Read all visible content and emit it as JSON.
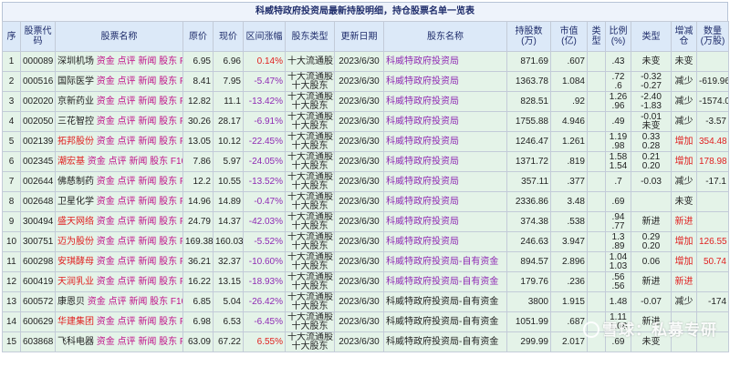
{
  "title": "科威特政府投资局最新持股明细，持仓股票名单一览表",
  "headers": [
    "序",
    "股票代码",
    "股票名称",
    "原价",
    "现价",
    "区间涨幅",
    "股东类型",
    "更新日期",
    "股东名称",
    "持股数(万)",
    "市值(亿)",
    "类型",
    "比例(%)",
    "类型",
    "增减仓",
    "数量(万股)"
  ],
  "links": [
    "资金",
    "点评",
    "新闻",
    "股东",
    "F10"
  ],
  "rows": [
    {
      "idx": "1",
      "code": "000089",
      "name": "深圳机场",
      "name_color": "nm",
      "orig": "6.95",
      "now": "6.96",
      "chg": "0.14%",
      "chg_up": true,
      "holder_type": [
        "十大流通股东"
      ],
      "date": "2023/6/30",
      "holder": "科威特政府投资局",
      "holder_color": "hold",
      "shares": "871.69",
      "mv": ".607",
      "ptype": "",
      "ratio": ".43",
      "t2": "未变",
      "act": "未变",
      "act_red": false,
      "qty": ""
    },
    {
      "idx": "2",
      "code": "000516",
      "name": "国际医学",
      "name_color": "nm",
      "orig": "8.41",
      "now": "7.95",
      "chg": "-5.47%",
      "chg_up": false,
      "holder_type": [
        "十大流通股东",
        "十大股东"
      ],
      "date": "2023/6/30",
      "holder": "科威特政府投资局",
      "holder_color": "hold",
      "shares": "1363.78",
      "mv": "1.084",
      "ptype": "",
      "ratio": ".72\n.6",
      "t2": "-0.32\n-0.27",
      "act": "减少",
      "act_red": false,
      "qty": "-619.96"
    },
    {
      "idx": "3",
      "code": "002020",
      "name": "京新药业",
      "name_color": "nm",
      "orig": "12.82",
      "now": "11.1",
      "chg": "-13.42%",
      "chg_up": false,
      "holder_type": [
        "十大流通股东",
        "十大股东"
      ],
      "date": "2023/6/30",
      "holder": "科威特政府投资局",
      "holder_color": "hold",
      "shares": "828.51",
      "mv": ".92",
      "ptype": "",
      "ratio": "1.26\n.96",
      "t2": "-2.40\n-1.83",
      "act": "减少",
      "act_red": false,
      "qty": "-1574.09"
    },
    {
      "idx": "4",
      "code": "002050",
      "name": "三花智控",
      "name_color": "nm",
      "orig": "30.26",
      "now": "28.17",
      "chg": "-6.91%",
      "chg_up": false,
      "holder_type": [
        "十大流通股东",
        "十大股东"
      ],
      "date": "2023/6/30",
      "holder": "科威特政府投资局",
      "holder_color": "hold",
      "shares": "1755.88",
      "mv": "4.946",
      "ptype": "",
      "ratio": ".49",
      "t2": "-0.01\n未变",
      "act": "减少",
      "act_red": false,
      "qty": "-3.57"
    },
    {
      "idx": "5",
      "code": "002139",
      "name": "拓邦股份",
      "name_color": "red",
      "orig": "13.05",
      "now": "10.12",
      "chg": "-22.45%",
      "chg_up": false,
      "holder_type": [
        "十大流通股东",
        "十大股东"
      ],
      "date": "2023/6/30",
      "holder": "科威特政府投资局",
      "holder_color": "hold",
      "shares": "1246.47",
      "mv": "1.261",
      "ptype": "",
      "ratio": "1.19\n.98",
      "t2": "0.33\n0.28",
      "act": "增加",
      "act_red": true,
      "qty": "354.48"
    },
    {
      "idx": "6",
      "code": "002345",
      "name": "潮宏基",
      "name_color": "red",
      "orig": "7.86",
      "now": "5.97",
      "chg": "-24.05%",
      "chg_up": false,
      "holder_type": [
        "十大流通股东",
        "十大股东"
      ],
      "date": "2023/6/30",
      "holder": "科威特政府投资局",
      "holder_color": "hold",
      "shares": "1371.72",
      "mv": ".819",
      "ptype": "",
      "ratio": "1.58\n1.54",
      "t2": "0.21\n0.20",
      "act": "增加",
      "act_red": true,
      "qty": "178.98"
    },
    {
      "idx": "7",
      "code": "002644",
      "name": "佛慈制药",
      "name_color": "nm",
      "orig": "12.2",
      "now": "10.55",
      "chg": "-13.52%",
      "chg_up": false,
      "holder_type": [
        "十大流通股东",
        "十大股东"
      ],
      "date": "2023/6/30",
      "holder": "科威特政府投资局",
      "holder_color": "hold",
      "shares": "357.11",
      "mv": ".377",
      "ptype": "",
      "ratio": ".7",
      "t2": "-0.03",
      "act": "减少",
      "act_red": false,
      "qty": "-17.1"
    },
    {
      "idx": "8",
      "code": "002648",
      "name": "卫星化学",
      "name_color": "nm",
      "orig": "14.96",
      "now": "14.89",
      "chg": "-0.47%",
      "chg_up": false,
      "holder_type": [
        "十大流通股东",
        "十大股东"
      ],
      "date": "2023/6/30",
      "holder": "科威特政府投资局",
      "holder_color": "hold",
      "shares": "2336.86",
      "mv": "3.48",
      "ptype": "",
      "ratio": ".69",
      "t2": "",
      "act": "未变",
      "act_red": false,
      "qty": ""
    },
    {
      "idx": "9",
      "code": "300494",
      "name": "盛天网络",
      "name_color": "red",
      "orig": "24.79",
      "now": "14.37",
      "chg": "-42.03%",
      "chg_up": false,
      "holder_type": [
        "十大流通股东",
        "十大股东"
      ],
      "date": "2023/6/30",
      "holder": "科威特政府投资局",
      "holder_color": "hold",
      "shares": "374.38",
      "mv": ".538",
      "ptype": "",
      "ratio": ".94\n.77",
      "t2": "新进",
      "act": "新进",
      "act_red": true,
      "qty": ""
    },
    {
      "idx": "10",
      "code": "300751",
      "name": "迈为股份",
      "name_color": "red",
      "orig": "169.38",
      "now": "160.03",
      "chg": "-5.52%",
      "chg_up": false,
      "holder_type": [
        "十大流通股东",
        "十大股东"
      ],
      "date": "2023/6/30",
      "holder": "科威特政府投资局",
      "holder_color": "hold",
      "shares": "246.63",
      "mv": "3.947",
      "ptype": "",
      "ratio": "1.3\n.89",
      "t2": "0.29\n0.20",
      "act": "增加",
      "act_red": true,
      "qty": "126.55"
    },
    {
      "idx": "11",
      "code": "600298",
      "name": "安琪酵母",
      "name_color": "red",
      "orig": "36.21",
      "now": "32.37",
      "chg": "-10.60%",
      "chg_up": false,
      "holder_type": [
        "十大流通股东",
        "十大股东"
      ],
      "date": "2023/6/30",
      "holder": "科威特政府投资局-自有资金",
      "holder_color": "hold",
      "shares": "894.57",
      "mv": "2.896",
      "ptype": "",
      "ratio": "1.04\n1.03",
      "t2": "0.06",
      "act": "增加",
      "act_red": true,
      "qty": "50.74"
    },
    {
      "idx": "12",
      "code": "600419",
      "name": "天润乳业",
      "name_color": "red",
      "orig": "16.22",
      "now": "13.15",
      "chg": "-18.93%",
      "chg_up": false,
      "holder_type": [
        "十大流通股东",
        "十大股东"
      ],
      "date": "2023/6/30",
      "holder": "科威特政府投资局-自有资金",
      "holder_color": "hold",
      "shares": "179.76",
      "mv": ".236",
      "ptype": "",
      "ratio": ".56\n.56",
      "t2": "新进",
      "act": "新进",
      "act_red": true,
      "qty": ""
    },
    {
      "idx": "13",
      "code": "600572",
      "name": "康恩贝",
      "name_color": "nm",
      "orig": "6.85",
      "now": "5.04",
      "chg": "-26.42%",
      "chg_up": false,
      "holder_type": [
        "十大流通股东",
        "十大股东"
      ],
      "date": "2023/6/30",
      "holder": "科威特政府投资局-自有资金",
      "holder_color": "nm",
      "shares": "3800",
      "mv": "1.915",
      "ptype": "",
      "ratio": "1.48",
      "t2": "-0.07",
      "act": "减少",
      "act_red": false,
      "qty": "-174"
    },
    {
      "idx": "14",
      "code": "600629",
      "name": "华建集团",
      "name_color": "red",
      "orig": "6.98",
      "now": "6.53",
      "chg": "-6.45%",
      "chg_up": false,
      "holder_type": [
        "十大流通股东",
        "十大股东"
      ],
      "date": "2023/6/30",
      "holder": "科威特政府投资局-自有资金",
      "holder_color": "nm",
      "shares": "1051.99",
      "mv": ".687",
      "ptype": "",
      "ratio": "1.11\n1.08",
      "t2": "新进",
      "act": "",
      "act_red": true,
      "qty": ""
    },
    {
      "idx": "15",
      "code": "603868",
      "name": "飞科电器",
      "name_color": "nm",
      "orig": "63.09",
      "now": "67.22",
      "chg": "6.55%",
      "chg_up": true,
      "holder_type": [
        "十大流通股东",
        "十大股东"
      ],
      "date": "2023/6/30",
      "holder": "科威特政府投资局-自有资金",
      "holder_color": "nm",
      "shares": "299.99",
      "mv": "2.017",
      "ptype": "",
      "ratio": ".69",
      "t2": "未变",
      "act": "",
      "act_red": false,
      "qty": ""
    }
  ],
  "watermark": "雪球：私募专研"
}
